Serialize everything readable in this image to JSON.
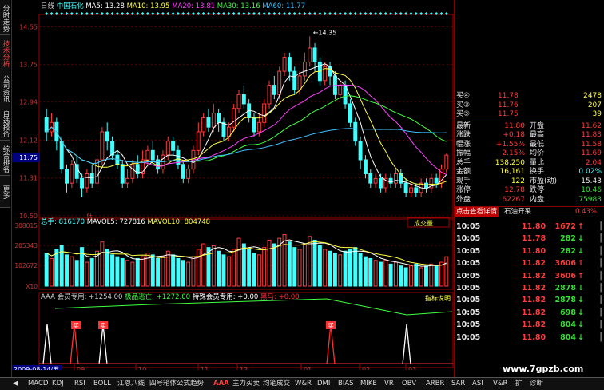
{
  "sidebar": {
    "tabs": [
      {
        "label": "分时走势",
        "active": false
      },
      {
        "label": "技术分析",
        "active": true
      },
      {
        "label": "公司资讯",
        "active": false
      },
      {
        "label": "自选报价",
        "active": false
      },
      {
        "label": "综合排名",
        "active": false
      },
      {
        "label": "更多",
        "active": false
      }
    ]
  },
  "main_chart": {
    "period": "日线",
    "stock_name": "中国石化",
    "ma_legend": [
      {
        "label": "MA5: 13.28",
        "color": "#ffffff"
      },
      {
        "label": "MA10: 13.95",
        "color": "#ffff40"
      },
      {
        "label": "MA20: 13.81",
        "color": "#ff40ff"
      },
      {
        "label": "MA30: 13.16",
        "color": "#40ff40"
      },
      {
        "label": "MA60: 11.77",
        "color": "#40c0ff"
      }
    ],
    "price_axis": [
      "14.55",
      "13.75",
      "12.94",
      "12.12",
      "11.31",
      "10.50"
    ],
    "price_min": 10.5,
    "price_max": 14.75,
    "current_price_tag": "11.75",
    "high_annotation": "14.35",
    "low_marker": "低"
  },
  "volume_chart": {
    "legend": [
      {
        "label": "总手: 816170",
        "color": "#40ffff"
      },
      {
        "label": "MAVOL5: 727816",
        "color": "#ffffff"
      },
      {
        "label": "MAVOL10: 804748",
        "color": "#ffff40"
      }
    ],
    "axis": [
      "308015",
      "205343",
      "102672",
      "X10"
    ],
    "vol_max": 308015,
    "button": "成交量"
  },
  "aaa_chart": {
    "legend": [
      {
        "label": "AAA 会员专用: +1254.00",
        "color": "#cccccc"
      },
      {
        "label": "极品逃亡: +1272.00",
        "color": "#40ff40"
      },
      {
        "label": "特殊会员专用: +0.00",
        "color": "#ffffff"
      },
      {
        "label": "黑马: +0.00",
        "color": "#ff3030"
      }
    ],
    "button": "指标说明",
    "signal_labels": [
      "买",
      "卖",
      "买"
    ]
  },
  "date_axis": {
    "date_tag": "2009-08-14/五",
    "months": [
      "09",
      "10",
      "11",
      "12",
      "01",
      "02",
      "03"
    ]
  },
  "quote_panel": {
    "bids": [
      {
        "label": "买④",
        "price": "11.78",
        "vol": "2478"
      },
      {
        "label": "买③",
        "price": "11.76",
        "vol": "207"
      },
      {
        "label": "买⑤",
        "price": "11.75",
        "vol": "39"
      }
    ],
    "stats": [
      {
        "l1": "最新",
        "v1": "11.80",
        "l2": "开盘",
        "v2": "11.62"
      },
      {
        "l1": "涨跌",
        "v1": "+0.18",
        "l2": "最高",
        "v2": "11.83"
      },
      {
        "l1": "幅涨",
        "v1": "+1.55%",
        "l2": "最低",
        "v2": "11.58"
      },
      {
        "l1": "振幅",
        "v1": "2.15%",
        "l2": "均价",
        "v2": "11.69"
      },
      {
        "l1": "总手",
        "v1": "138,250",
        "l2": "量比",
        "v2": "2.04"
      },
      {
        "l1": "金额",
        "v1": "16,161",
        "l2": "换手",
        "v2": "0.02%"
      },
      {
        "l1": "现手",
        "v1": "122",
        "l2": "市盈(动)",
        "v2": "15.43"
      },
      {
        "l1": "涨停",
        "v1": "12.78",
        "l2": "跌停",
        "v2": "10.46"
      },
      {
        "l1": "外盘",
        "v1": "62267",
        "l2": "内盘",
        "v2": "75983"
      }
    ],
    "banner_link": "点击查看详情",
    "banner_name": "石油开采",
    "banner_pct": "0.43%",
    "ticks": [
      {
        "time": "10:05",
        "price": "11.80",
        "vol": "1672",
        "dir": "up"
      },
      {
        "time": "10:05",
        "price": "11.78",
        "vol": "282",
        "dir": "down"
      },
      {
        "time": "10:05",
        "price": "11.80",
        "vol": "282",
        "dir": "down"
      },
      {
        "time": "10:05",
        "price": "11.82",
        "vol": "3606",
        "dir": "up"
      },
      {
        "time": "10:05",
        "price": "11.82",
        "vol": "3606",
        "dir": "up"
      },
      {
        "time": "10:05",
        "price": "11.82",
        "vol": "2878",
        "dir": "down"
      },
      {
        "time": "10:05",
        "price": "11.82",
        "vol": "2878",
        "dir": "down"
      },
      {
        "time": "10:05",
        "price": "11.82",
        "vol": "698",
        "dir": "down"
      },
      {
        "time": "10:05",
        "price": "11.82",
        "vol": "804",
        "dir": "down"
      },
      {
        "time": "10:05",
        "price": "11.80",
        "vol": "804",
        "dir": "down"
      }
    ],
    "watermark": "www.7gpzb.com"
  },
  "bottom_tabs": [
    "MACD",
    "KDJ",
    "RSI",
    "BOLL",
    "江恩八线",
    "四号箱体公式趋势",
    "AAA",
    "主力买卖",
    "均笔成交",
    "W&R",
    "DMI",
    "BIAS",
    "MIKE",
    "VR",
    "OBV",
    "ARBR",
    "SAR",
    "ASI",
    "V&R",
    "扩",
    "诊断"
  ],
  "bottom_active": "AAA",
  "chart_data": {
    "type": "candlestick",
    "colors": {
      "up": "#ff3c3c",
      "down": "#40ffff"
    },
    "candles": [
      [
        12.6,
        12.3,
        12.8,
        12.1
      ],
      [
        12.3,
        12.5,
        12.7,
        12.2
      ],
      [
        12.5,
        12.1,
        12.6,
        11.9
      ],
      [
        12.1,
        11.5,
        12.2,
        11.4
      ],
      [
        11.5,
        11.2,
        11.6,
        11.0
      ],
      [
        11.2,
        11.6,
        11.7,
        11.1
      ],
      [
        11.6,
        11.3,
        11.8,
        11.2
      ],
      [
        11.3,
        11.1,
        11.4,
        10.9
      ],
      [
        11.1,
        11.4,
        11.5,
        11.0
      ],
      [
        11.4,
        11.2,
        11.6,
        11.1
      ],
      [
        11.2,
        11.7,
        11.8,
        11.1
      ],
      [
        11.7,
        12.3,
        12.4,
        11.6
      ],
      [
        12.3,
        12.1,
        12.5,
        11.9
      ],
      [
        12.1,
        11.8,
        12.2,
        11.7
      ],
      [
        11.8,
        11.6,
        11.9,
        11.5
      ],
      [
        11.6,
        11.2,
        11.7,
        11.1
      ],
      [
        11.2,
        11.3,
        11.5,
        11.1
      ],
      [
        11.3,
        11.6,
        11.7,
        11.2
      ],
      [
        11.6,
        11.4,
        11.8,
        11.3
      ],
      [
        11.4,
        11.7,
        11.9,
        11.3
      ],
      [
        11.7,
        11.9,
        12.0,
        11.6
      ],
      [
        11.9,
        11.7,
        12.1,
        11.6
      ],
      [
        11.7,
        11.5,
        11.8,
        11.4
      ],
      [
        11.5,
        11.8,
        11.9,
        11.4
      ],
      [
        11.8,
        12.1,
        12.2,
        11.7
      ],
      [
        12.1,
        11.9,
        12.2,
        11.8
      ],
      [
        11.9,
        11.6,
        12.0,
        11.5
      ],
      [
        11.6,
        11.3,
        11.7,
        11.2
      ],
      [
        11.3,
        11.5,
        11.6,
        11.2
      ],
      [
        11.5,
        11.9,
        12.0,
        11.4
      ],
      [
        11.9,
        12.3,
        12.5,
        11.8
      ],
      [
        12.3,
        12.6,
        12.7,
        12.2
      ],
      [
        12.6,
        12.4,
        12.8,
        12.3
      ],
      [
        12.4,
        12.7,
        12.9,
        12.3
      ],
      [
        12.7,
        12.5,
        12.8,
        12.3
      ],
      [
        12.5,
        12.2,
        12.6,
        12.1
      ],
      [
        12.2,
        12.4,
        12.5,
        12.1
      ],
      [
        12.4,
        12.8,
        12.9,
        12.3
      ],
      [
        12.8,
        13.1,
        13.2,
        12.7
      ],
      [
        13.1,
        12.9,
        13.3,
        12.8
      ],
      [
        12.9,
        12.6,
        13.0,
        12.5
      ],
      [
        12.6,
        12.3,
        12.7,
        12.2
      ],
      [
        12.3,
        12.5,
        12.7,
        12.2
      ],
      [
        12.5,
        12.9,
        13.0,
        12.4
      ],
      [
        12.9,
        13.3,
        13.4,
        12.8
      ],
      [
        13.3,
        13.1,
        13.5,
        13.0
      ],
      [
        13.1,
        13.6,
        13.7,
        13.0
      ],
      [
        13.6,
        13.9,
        14.0,
        13.5
      ],
      [
        13.9,
        13.6,
        14.0,
        13.4
      ],
      [
        13.6,
        13.2,
        13.7,
        13.1
      ],
      [
        13.2,
        13.5,
        13.6,
        13.1
      ],
      [
        13.5,
        13.8,
        14.0,
        13.4
      ],
      [
        13.8,
        14.1,
        14.35,
        13.7
      ],
      [
        14.1,
        13.8,
        14.2,
        13.6
      ],
      [
        13.8,
        13.4,
        13.9,
        13.3
      ],
      [
        13.4,
        13.7,
        13.8,
        13.3
      ],
      [
        13.7,
        13.5,
        13.8,
        13.3
      ],
      [
        13.5,
        13.1,
        13.6,
        13.0
      ],
      [
        13.1,
        13.3,
        13.4,
        13.0
      ],
      [
        13.3,
        12.9,
        13.4,
        12.8
      ],
      [
        12.9,
        12.5,
        13.0,
        12.4
      ],
      [
        12.5,
        12.1,
        12.6,
        12.0
      ],
      [
        12.1,
        11.7,
        12.2,
        11.5
      ],
      [
        11.7,
        11.4,
        11.8,
        11.3
      ],
      [
        11.4,
        11.2,
        11.5,
        11.1
      ],
      [
        11.2,
        11.3,
        11.4,
        11.1
      ],
      [
        11.3,
        11.1,
        11.4,
        11.0
      ],
      [
        11.1,
        11.3,
        11.4,
        11.0
      ],
      [
        11.3,
        11.2,
        11.4,
        11.1
      ],
      [
        11.2,
        11.4,
        11.5,
        11.1
      ],
      [
        11.4,
        11.2,
        11.5,
        11.1
      ],
      [
        11.2,
        11.0,
        11.3,
        10.9
      ],
      [
        11.0,
        11.1,
        11.2,
        10.9
      ],
      [
        11.1,
        11.0,
        11.2,
        10.9
      ],
      [
        11.0,
        11.2,
        11.3,
        10.9
      ],
      [
        11.2,
        11.1,
        11.3,
        11.0
      ],
      [
        11.1,
        11.3,
        11.4,
        11.0
      ],
      [
        11.3,
        11.2,
        11.4,
        11.1
      ],
      [
        11.2,
        11.5,
        11.6,
        11.1
      ],
      [
        11.5,
        11.8,
        11.83,
        11.4
      ]
    ],
    "volumes": [
      180,
      150,
      200,
      220,
      170,
      160,
      140,
      210,
      130,
      150,
      190,
      240,
      200,
      170,
      160,
      150,
      140,
      130,
      150,
      160,
      180,
      170,
      150,
      160,
      190,
      170,
      150,
      140,
      130,
      160,
      200,
      230,
      210,
      220,
      190,
      170,
      160,
      200,
      260,
      230,
      200,
      180,
      170,
      210,
      250,
      230,
      260,
      280,
      240,
      210,
      200,
      230,
      270,
      250,
      220,
      200,
      190,
      180,
      170,
      190,
      200,
      210,
      180,
      160,
      150,
      140,
      130,
      140,
      120,
      130,
      110,
      100,
      110,
      120,
      100,
      110,
      120,
      110,
      130,
      160
    ]
  }
}
